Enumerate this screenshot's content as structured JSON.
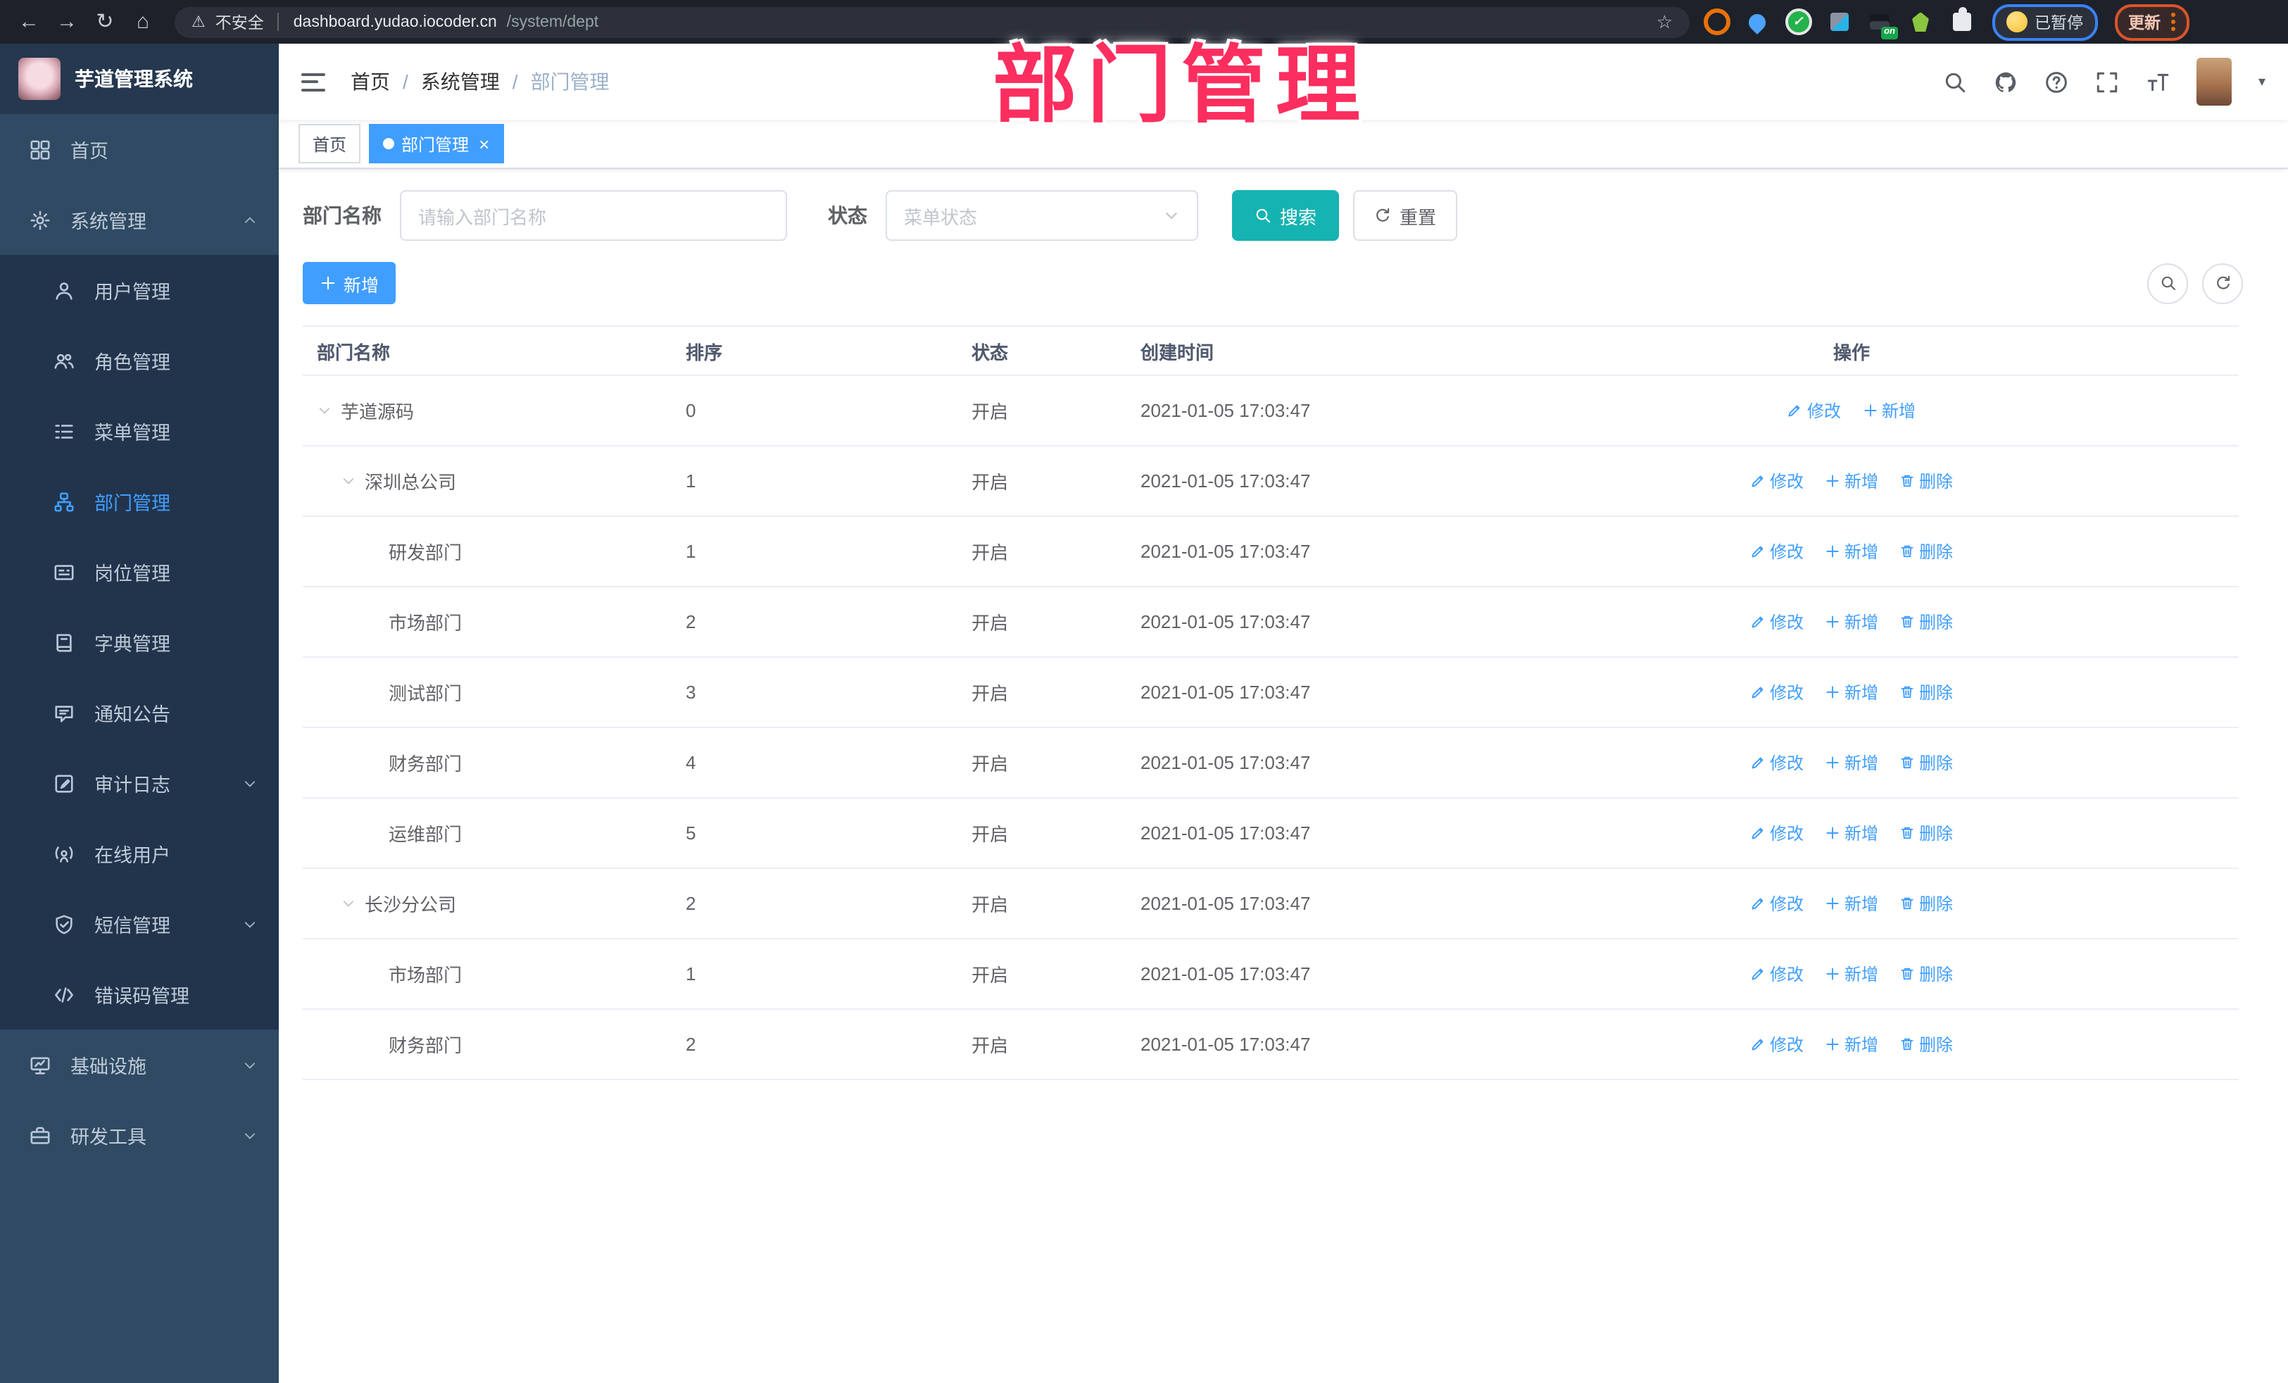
{
  "annotation": {
    "title": "部门管理"
  },
  "browser": {
    "security_label": "不安全",
    "url_host": "dashboard.yudao.iocoder.cn",
    "url_path": "/system/dept",
    "extension_badge": "on",
    "profile_label": "已暂停",
    "update_label": "更新"
  },
  "sidebar": {
    "app_title": "芋道管理系统",
    "items": [
      {
        "label": "首页",
        "icon": "dashboard-icon",
        "type": "root"
      },
      {
        "label": "系统管理",
        "icon": "gear-icon",
        "type": "root",
        "arrow": "up"
      },
      {
        "label": "用户管理",
        "icon": "user-icon",
        "type": "sub"
      },
      {
        "label": "角色管理",
        "icon": "users-icon",
        "type": "sub"
      },
      {
        "label": "菜单管理",
        "icon": "menu-tree-icon",
        "type": "sub"
      },
      {
        "label": "部门管理",
        "icon": "org-tree-icon",
        "type": "sub",
        "active": true
      },
      {
        "label": "岗位管理",
        "icon": "id-card-icon",
        "type": "sub"
      },
      {
        "label": "字典管理",
        "icon": "dictionary-icon",
        "type": "sub"
      },
      {
        "label": "通知公告",
        "icon": "announcement-icon",
        "type": "sub"
      },
      {
        "label": "审计日志",
        "icon": "audit-log-icon",
        "type": "sub",
        "arrow": "down"
      },
      {
        "label": "在线用户",
        "icon": "online-users-icon",
        "type": "sub"
      },
      {
        "label": "短信管理",
        "icon": "sms-shield-icon",
        "type": "sub",
        "arrow": "down"
      },
      {
        "label": "错误码管理",
        "icon": "code-icon",
        "type": "sub"
      },
      {
        "label": "基础设施",
        "icon": "infrastructure-icon",
        "type": "root",
        "arrow": "down"
      },
      {
        "label": "研发工具",
        "icon": "dev-tools-icon",
        "type": "root",
        "arrow": "down"
      }
    ]
  },
  "header": {
    "separator": "/",
    "breadcrumbs": [
      {
        "label": "首页"
      },
      {
        "label": "系统管理"
      },
      {
        "label": "部门管理",
        "current": true
      }
    ]
  },
  "tabs": [
    {
      "label": "首页"
    },
    {
      "label": "部门管理",
      "active": true,
      "closable": true
    }
  ],
  "filter": {
    "name_label": "部门名称",
    "name_placeholder": "请输入部门名称",
    "status_label": "状态",
    "status_placeholder": "菜单状态",
    "search_label": "搜索",
    "reset_label": "重置"
  },
  "toolbar": {
    "add_label": "新增"
  },
  "table": {
    "columns": [
      "部门名称",
      "排序",
      "状态",
      "创建时间",
      "操作"
    ],
    "action_labels": {
      "edit": "修改",
      "add": "新增",
      "delete": "删除"
    },
    "rows": [
      {
        "name": "芋道源码",
        "sort": "0",
        "status": "开启",
        "time": "2021-01-05 17:03:47",
        "level": 1,
        "expandable": true,
        "actions": [
          "edit",
          "add"
        ]
      },
      {
        "name": "深圳总公司",
        "sort": "1",
        "status": "开启",
        "time": "2021-01-05 17:03:47",
        "level": 2,
        "expandable": true,
        "actions": [
          "edit",
          "add",
          "delete"
        ]
      },
      {
        "name": "研发部门",
        "sort": "1",
        "status": "开启",
        "time": "2021-01-05 17:03:47",
        "level": 3,
        "expandable": false,
        "actions": [
          "edit",
          "add",
          "delete"
        ]
      },
      {
        "name": "市场部门",
        "sort": "2",
        "status": "开启",
        "time": "2021-01-05 17:03:47",
        "level": 3,
        "expandable": false,
        "actions": [
          "edit",
          "add",
          "delete"
        ]
      },
      {
        "name": "测试部门",
        "sort": "3",
        "status": "开启",
        "time": "2021-01-05 17:03:47",
        "level": 3,
        "expandable": false,
        "actions": [
          "edit",
          "add",
          "delete"
        ]
      },
      {
        "name": "财务部门",
        "sort": "4",
        "status": "开启",
        "time": "2021-01-05 17:03:47",
        "level": 3,
        "expandable": false,
        "actions": [
          "edit",
          "add",
          "delete"
        ]
      },
      {
        "name": "运维部门",
        "sort": "5",
        "status": "开启",
        "time": "2021-01-05 17:03:47",
        "level": 3,
        "expandable": false,
        "actions": [
          "edit",
          "add",
          "delete"
        ]
      },
      {
        "name": "长沙分公司",
        "sort": "2",
        "status": "开启",
        "time": "2021-01-05 17:03:47",
        "level": 2,
        "expandable": true,
        "actions": [
          "edit",
          "add",
          "delete"
        ]
      },
      {
        "name": "市场部门",
        "sort": "1",
        "status": "开启",
        "time": "2021-01-05 17:03:47",
        "level": 3,
        "expandable": false,
        "actions": [
          "edit",
          "add",
          "delete"
        ]
      },
      {
        "name": "财务部门",
        "sort": "2",
        "status": "开启",
        "time": "2021-01-05 17:03:47",
        "level": 3,
        "expandable": false,
        "actions": [
          "edit",
          "add",
          "delete"
        ]
      }
    ]
  },
  "colors": {
    "accent": "#409eff",
    "search_button": "#16b3b3",
    "sidebar_bg": "#2f4a62",
    "submenu_bg": "#22344c",
    "annotation": "#fb2e5f"
  }
}
